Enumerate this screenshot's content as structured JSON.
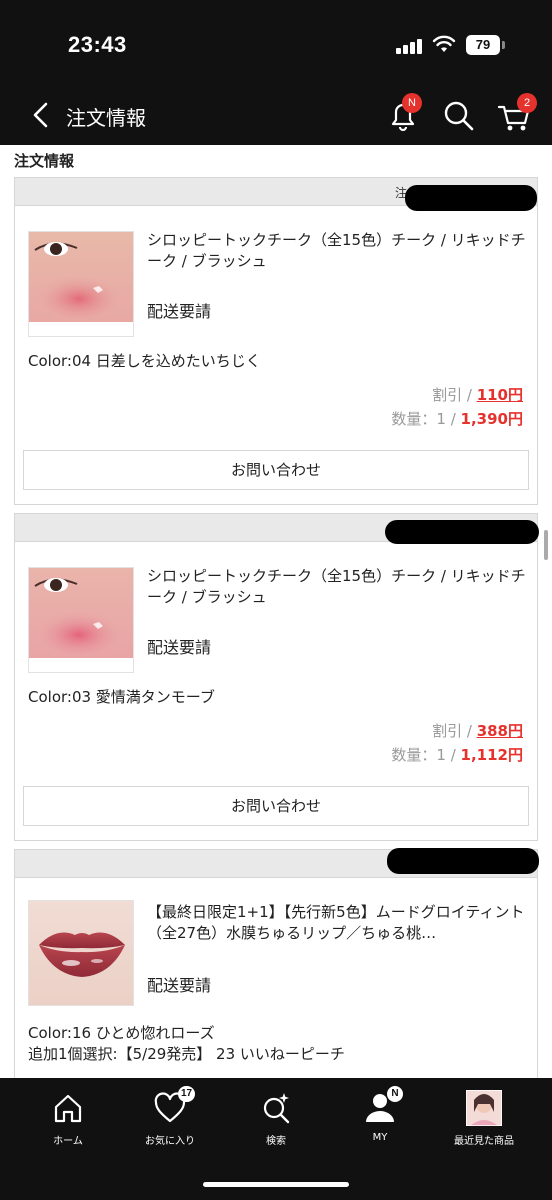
{
  "status_bar": {
    "time": "23:43",
    "battery": "79"
  },
  "nav": {
    "title": "注文情報",
    "notification_badge": "N",
    "cart_badge": "2"
  },
  "section_heading": "注文情報",
  "orders": [
    {
      "header_label": "注",
      "product_name": "シロッピートックチーク（全15色）チーク / リキッドチーク / ブラッシュ",
      "status": "配送要請",
      "option": "Color:04 日差しを込めたいちじく",
      "option2": "",
      "discount_label": "割引 / ",
      "discount_value": "110円",
      "qty_label": "数量：1 / ",
      "price": "1,390円",
      "inquiry_label": "お問い合わせ",
      "thumb": "cheek"
    },
    {
      "header_label": "",
      "product_name": "シロッピートックチーク（全15色）チーク / リキッドチーク / ブラッシュ",
      "status": "配送要請",
      "option": "Color:03 愛情満タンモーブ",
      "option2": "",
      "discount_label": "割引 / ",
      "discount_value": "388円",
      "qty_label": "数量：1 / ",
      "price": "1,112円",
      "inquiry_label": "お問い合わせ",
      "thumb": "cheek"
    },
    {
      "header_label": "",
      "product_name": "【最終日限定1+1】【先行新5色】ムードグロイティント（全27色）水膜ちゅるリップ／ちゅる桃…",
      "status": "配送要請",
      "option": "Color:16 ひとめ惚れローズ",
      "option2": "追加1個選択:【5/29発売】 23 いいねーピーチ",
      "discount_label": "",
      "discount_value": "",
      "qty_label": "",
      "price": "",
      "inquiry_label": "",
      "thumb": "lips"
    }
  ],
  "tabs": [
    {
      "label": "ホーム",
      "icon": "home-icon",
      "badge": ""
    },
    {
      "label": "お気に入り",
      "icon": "heart-icon",
      "badge": "17"
    },
    {
      "label": "検索",
      "icon": "search-sparkle-icon",
      "badge": ""
    },
    {
      "label": "MY",
      "icon": "person-icon",
      "badge": "N"
    },
    {
      "label": "最近見た商品",
      "icon": "recent-product-thumbnail",
      "badge": ""
    }
  ],
  "colors": {
    "accent_red": "#e5322d",
    "bar_bg": "#111111",
    "card_header": "#e9e9e9"
  }
}
